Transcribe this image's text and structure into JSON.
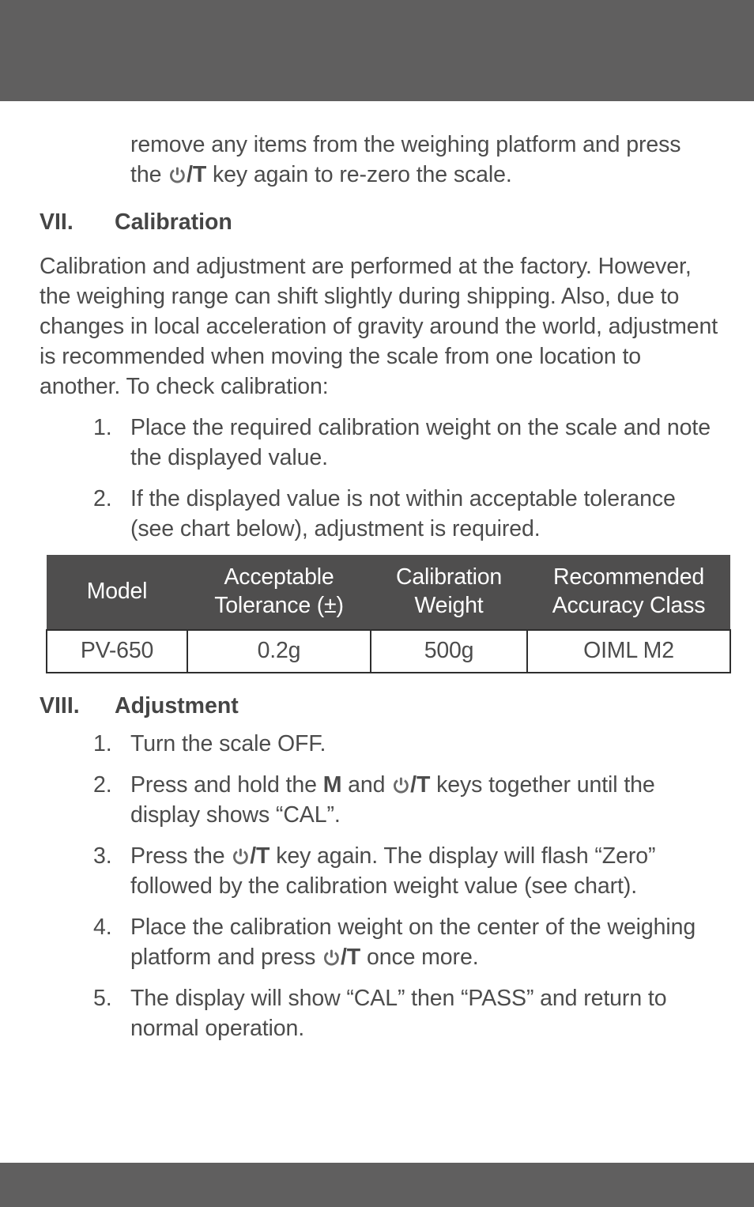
{
  "page": {
    "header_band_color": "#605f5f",
    "footer_band_color": "#605f5f",
    "body_text_color": "#4c4c4c",
    "table_header_bg": "#4f4e4e",
    "table_header_text": "#ffffff",
    "table_border_color": "#2e2e2e"
  },
  "continued_paragraph": {
    "line1": "remove any items from the weighing platform and",
    "line2_before": "press the ",
    "line2_key": "/T",
    "line2_after": " key again to re-zero the scale."
  },
  "sections": [
    {
      "number": "VII.",
      "title": "Calibration",
      "paragraph": "Calibration and adjustment are performed at the factory. However, the weighing range can shift slightly during shipping. Also, due to changes in local acceleration of gravity around the world, adjustment is recommended when moving the scale from one location to another. To check calibration:",
      "items": [
        {
          "marker": "1.",
          "text": "Place the required calibration weight on the scale and note the displayed value."
        },
        {
          "marker": "2.",
          "text": "If the displayed value is not within acceptable tolerance (see chart below), adjustment is required."
        }
      ]
    },
    {
      "number": "VIII.",
      "title": "Adjustment"
    }
  ],
  "table": {
    "headers": [
      "Model",
      "Acceptable Tolerance (±)",
      "Calibration Weight",
      "Recommended Accuracy Class"
    ],
    "header_lines": [
      [
        "Model",
        ""
      ],
      [
        "Acceptable",
        "Tolerance (±)"
      ],
      [
        "Calibration",
        "Weight"
      ],
      [
        "Recommended",
        "Accuracy Class"
      ]
    ],
    "rows": [
      [
        "PV-650",
        "0.2g",
        "500g",
        "OIML M2"
      ]
    ]
  },
  "adjustment_items": [
    {
      "marker": "1.",
      "parts": [
        {
          "type": "text",
          "value": "Turn the scale OFF."
        }
      ]
    },
    {
      "marker": "2.",
      "parts": [
        {
          "type": "text",
          "value": "Press and hold the "
        },
        {
          "type": "bold",
          "value": "M"
        },
        {
          "type": "text",
          "value": " and "
        },
        {
          "type": "powerkey",
          "value": "/T"
        },
        {
          "type": "text",
          "value": "  keys together until the display shows “CAL”."
        }
      ]
    },
    {
      "marker": "3.",
      "parts": [
        {
          "type": "text",
          "value": "Press the "
        },
        {
          "type": "powerkey",
          "value": "/T"
        },
        {
          "type": "text",
          "value": " key again. The display will flash “Zero” followed by the calibration weight value (see chart)."
        }
      ]
    },
    {
      "marker": "4.",
      "parts": [
        {
          "type": "text",
          "value": "Place the calibration weight on the center of the weighing platform and press "
        },
        {
          "type": "powerkey",
          "value": "/T"
        },
        {
          "type": "text",
          "value": " once more."
        }
      ]
    },
    {
      "marker": "5.",
      "parts": [
        {
          "type": "text",
          "value": "The display will show “CAL” then “PASS” and return to normal operation."
        }
      ]
    }
  ],
  "icons": {
    "power_key": "power-icon"
  }
}
